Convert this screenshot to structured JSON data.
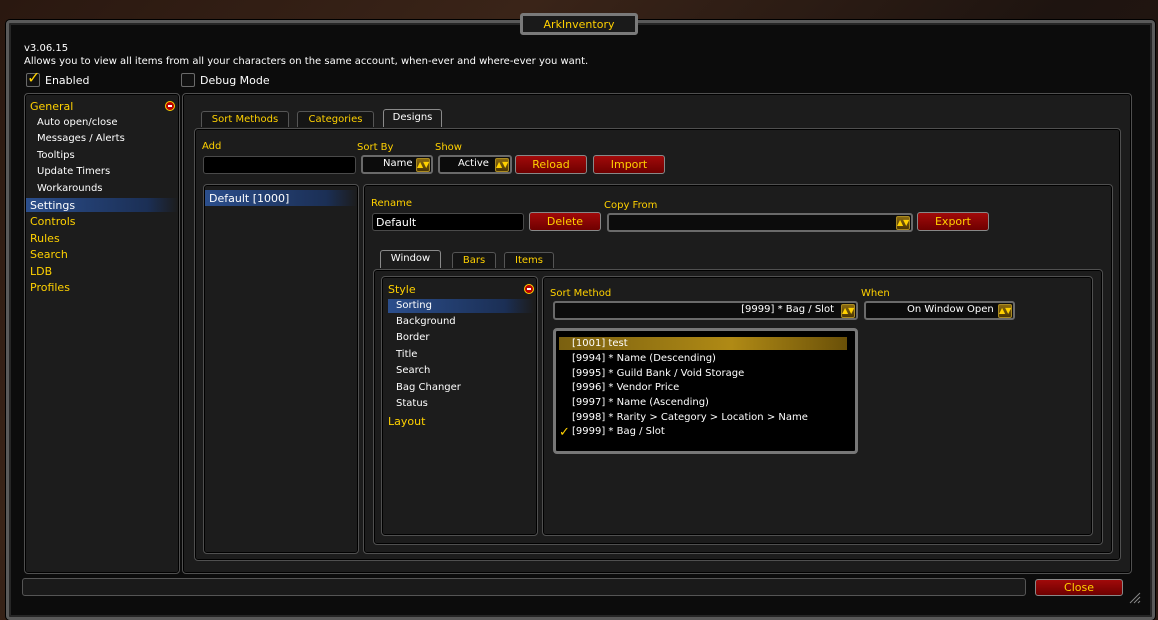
{
  "window": {
    "title": "ArkInventory",
    "version": "v3.06.15",
    "description": "Allows you to view all items from all your characters on the same account, when-ever and where-ever you want."
  },
  "options": {
    "enabled_label": "Enabled",
    "enabled_checked": true,
    "debug_label": "Debug Mode",
    "debug_checked": false
  },
  "nav": {
    "general": "General",
    "sub": [
      "Auto open/close",
      "Messages / Alerts",
      "Tooltips",
      "Update Timers",
      "Workarounds"
    ],
    "sections": [
      "Settings",
      "Controls",
      "Rules",
      "Search",
      "LDB",
      "Profiles"
    ],
    "selected": "Settings"
  },
  "top_tabs": [
    "Sort Methods",
    "Categories",
    "Designs"
  ],
  "top_tab_active": "Designs",
  "add": {
    "label": "Add",
    "value": ""
  },
  "sort_by": {
    "label": "Sort By",
    "value": "Name"
  },
  "show": {
    "label": "Show",
    "value": "Active"
  },
  "buttons": {
    "reload": "Reload",
    "import": "Import",
    "delete": "Delete",
    "export": "Export",
    "close": "Close"
  },
  "design_list": [
    "Default [1000]"
  ],
  "rename": {
    "label": "Rename",
    "value": "Default"
  },
  "copy_from": {
    "label": "Copy From",
    "value": ""
  },
  "inner_tabs": [
    "Window",
    "Bars",
    "Items"
  ],
  "inner_tab_active": "Window",
  "style": {
    "header": "Style",
    "items": [
      "Sorting",
      "Background",
      "Border",
      "Title",
      "Search",
      "Bag Changer",
      "Status"
    ],
    "selected": "Sorting",
    "layout": "Layout"
  },
  "sort_method": {
    "label": "Sort Method",
    "value": "[9999] * Bag / Slot"
  },
  "when": {
    "label": "When",
    "value": "On Window Open"
  },
  "dropdown_options": [
    "[1001] test",
    "[9994] * Name (Descending)",
    "[9995] * Guild Bank / Void Storage",
    "[9996] * Vendor Price",
    "[9997] * Name (Ascending)",
    "[9998] * Rarity > Category > Location > Name",
    "[9999] * Bag / Slot"
  ],
  "dropdown_highlighted": "[1001] test",
  "dropdown_checked": "[9999] * Bag / Slot",
  "status_bar": {
    "text": ""
  },
  "colors": {
    "accent": "#ffd100",
    "selection": "#2b4e8c",
    "button": "#8b0000"
  }
}
